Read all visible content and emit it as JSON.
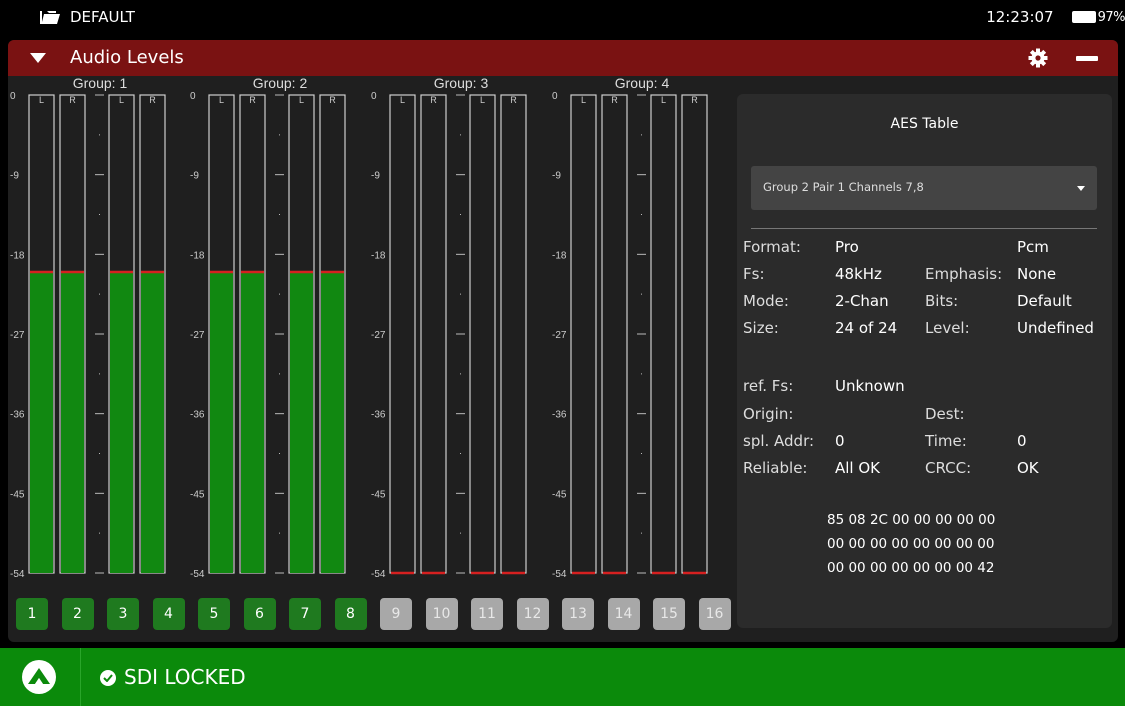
{
  "status_bar": {
    "profile": "DEFAULT",
    "time": "12:23:07",
    "battery": "97%"
  },
  "panel": {
    "title": "Audio Levels"
  },
  "meters": {
    "scale_labels": [
      "0",
      "-9",
      "-18",
      "-27",
      "-36",
      "-45",
      "-54"
    ],
    "groups": [
      {
        "label": "Group: 1",
        "channels": [
          {
            "label": "L",
            "level_db": -20
          },
          {
            "label": "R",
            "level_db": -20
          },
          {
            "label": "L",
            "level_db": -20
          },
          {
            "label": "R",
            "level_db": -20
          }
        ]
      },
      {
        "label": "Group: 2",
        "channels": [
          {
            "label": "L",
            "level_db": -20
          },
          {
            "label": "R",
            "level_db": -20
          },
          {
            "label": "L",
            "level_db": -20
          },
          {
            "label": "R",
            "level_db": -20
          }
        ]
      },
      {
        "label": "Group: 3",
        "channels": [
          {
            "label": "L",
            "level_db": -54
          },
          {
            "label": "R",
            "level_db": -54
          },
          {
            "label": "L",
            "level_db": -54
          },
          {
            "label": "R",
            "level_db": -54
          }
        ]
      },
      {
        "label": "Group: 4",
        "channels": [
          {
            "label": "L",
            "level_db": -54
          },
          {
            "label": "R",
            "level_db": -54
          },
          {
            "label": "L",
            "level_db": -54
          },
          {
            "label": "R",
            "level_db": -54
          }
        ]
      }
    ],
    "colors": {
      "fill": "#118811",
      "peak": "#d62020",
      "frame": "#cfcfcf"
    }
  },
  "channel_buttons": [
    {
      "label": "1",
      "active": true
    },
    {
      "label": "2",
      "active": true
    },
    {
      "label": "3",
      "active": true
    },
    {
      "label": "4",
      "active": true
    },
    {
      "label": "5",
      "active": true
    },
    {
      "label": "6",
      "active": true
    },
    {
      "label": "7",
      "active": true
    },
    {
      "label": "8",
      "active": true
    },
    {
      "label": "9",
      "active": false
    },
    {
      "label": "10",
      "active": false
    },
    {
      "label": "11",
      "active": false
    },
    {
      "label": "12",
      "active": false
    },
    {
      "label": "13",
      "active": false
    },
    {
      "label": "14",
      "active": false
    },
    {
      "label": "15",
      "active": false
    },
    {
      "label": "16",
      "active": false
    }
  ],
  "aes_table": {
    "title": "AES Table",
    "selected_pair": "Group 2 Pair 1 Channels 7,8",
    "format_label": "Format:",
    "format_value": "Pro",
    "format_extra": "Pcm",
    "fs_label": "Fs:",
    "fs_value": "48kHz",
    "emphasis_label": "Emphasis:",
    "emphasis_value": "None",
    "mode_label": "Mode:",
    "mode_value": "2-Chan",
    "bits_label": "Bits:",
    "bits_value": "Default",
    "size_label": "Size:",
    "size_value": "24 of 24",
    "level_label": "Level:",
    "level_value": "Undefined",
    "ref_fs_label": "ref. Fs:",
    "ref_fs_value": "Unknown",
    "origin_label": "Origin:",
    "dest_label": "Dest:",
    "spl_addr_label": "spl. Addr:",
    "spl_addr_value": "0",
    "time_label": "Time:",
    "time_value": "0",
    "reliable_label": "Reliable:",
    "reliable_value": "All OK",
    "crcc_label": "CRCC:",
    "crcc_value": "OK",
    "hex_lines": [
      "85 08 2C 00 00 00 00 00",
      "00 00 00 00 00 00 00 00",
      "00 00 00 00 00 00 00 42"
    ]
  },
  "footer": {
    "status": "SDI LOCKED",
    "color": "#0b8a0b"
  }
}
